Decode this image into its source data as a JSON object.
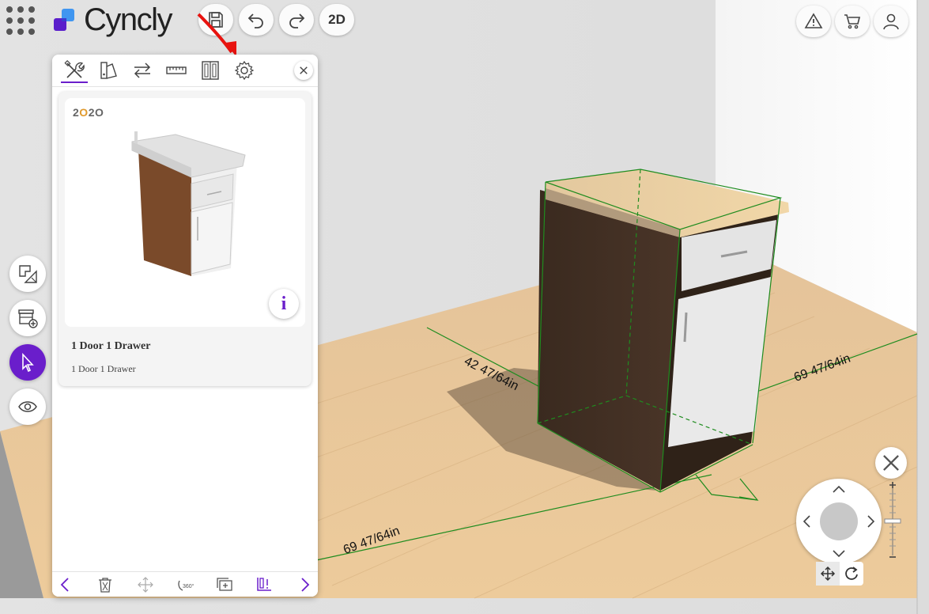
{
  "app": {
    "name": "Cyncly",
    "toolbar": {
      "mode_2d_label": "2D"
    }
  },
  "panel": {
    "tabs": [
      {
        "name": "tools",
        "icon": "tools-icon",
        "active": true
      },
      {
        "name": "catalog",
        "icon": "catalog-icon",
        "active": false
      },
      {
        "name": "swap",
        "icon": "swap-arrows-icon",
        "active": false
      },
      {
        "name": "measure",
        "icon": "ruler-icon",
        "active": false
      },
      {
        "name": "door-style",
        "icon": "cabinet-doors-icon",
        "active": false
      },
      {
        "name": "settings",
        "icon": "gear-icon",
        "active": false
      }
    ],
    "product": {
      "brand_prefix": "2",
      "brand_o1": "O",
      "brand_mid": "2",
      "brand_o2": "O",
      "title": "1 Door 1 Drawer",
      "subtitle": "1 Door 1 Drawer",
      "info_label": "i"
    },
    "bottom_toolbar": [
      "chevron-left-icon",
      "trash-icon",
      "move-arrows-icon",
      "rotate-360-icon",
      "duplicate-icon",
      "align-icon",
      "chevron-right-icon"
    ]
  },
  "scene": {
    "dimensions": {
      "depth_label": "42 47/64in",
      "right_label": "69 47/64in",
      "front_label": "69 47/64in"
    },
    "colors": {
      "accent": "#6a1ecb",
      "selection_outline": "#1f8c1f",
      "floor": "#e9c593",
      "wall": "#e2e2e2"
    }
  }
}
